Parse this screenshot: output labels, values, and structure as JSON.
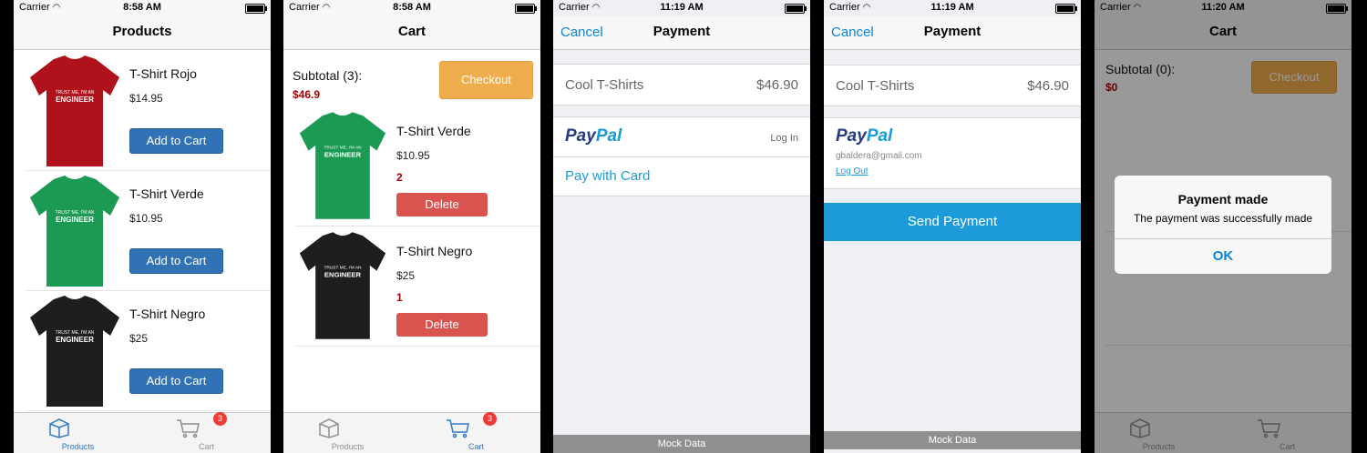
{
  "screens": [
    {
      "status": {
        "carrier": "Carrier",
        "time": "8:58 AM"
      },
      "nav_title": "Products",
      "products": [
        {
          "name": "T-Shirt Rojo",
          "price": "$14.95",
          "button": "Add to Cart",
          "color": "#b0121b"
        },
        {
          "name": "T-Shirt Verde",
          "price": "$10.95",
          "button": "Add to Cart",
          "color": "#1c9a53"
        },
        {
          "name": "T-Shirt Negro",
          "price": "$25",
          "button": "Add to Cart",
          "color": "#1e1e1e"
        }
      ],
      "shirt_text": {
        "line1": "TRUST ME, I'M AN",
        "line2": "ENGINEER"
      },
      "tabs": {
        "products": "Products",
        "cart": "Cart",
        "badge": "3"
      }
    },
    {
      "status": {
        "carrier": "Carrier",
        "time": "8:58 AM"
      },
      "nav_title": "Cart",
      "subtotal_label": "Subtotal (3):",
      "subtotal_amount": "$46.9",
      "checkout": "Checkout",
      "items": [
        {
          "name": "T-Shirt Verde",
          "price": "$10.95",
          "qty": "2",
          "button": "Delete",
          "color": "#1c9a53"
        },
        {
          "name": "T-Shirt Negro",
          "price": "$25",
          "qty": "1",
          "button": "Delete",
          "color": "#1e1e1e"
        }
      ],
      "tabs": {
        "products": "Products",
        "cart": "Cart",
        "badge": "3"
      }
    },
    {
      "status": {
        "carrier": "Carrier",
        "time": "11:19 AM"
      },
      "cancel": "Cancel",
      "nav_title": "Payment",
      "merchant": "Cool T-Shirts",
      "amount": "$46.90",
      "paypal": {
        "part1": "Pay",
        "part2": "Pal"
      },
      "login": "Log In",
      "pay_card": "Pay with Card",
      "mock": "Mock Data"
    },
    {
      "status": {
        "carrier": "Carrier",
        "time": "11:19 AM"
      },
      "cancel": "Cancel",
      "nav_title": "Payment",
      "merchant": "Cool T-Shirts",
      "amount": "$46.90",
      "paypal": {
        "part1": "Pay",
        "part2": "Pal"
      },
      "email": "gbaldera@gmail.com",
      "logout": "Log Out",
      "send": "Send Payment",
      "mock": "Mock Data"
    },
    {
      "status": {
        "carrier": "Carrier",
        "time": "11:20 AM"
      },
      "nav_title": "Cart",
      "subtotal_label": "Subtotal (0):",
      "subtotal_amount": "$0",
      "checkout": "Checkout",
      "alert": {
        "title": "Payment made",
        "message": "The payment was successfully made",
        "ok": "OK"
      },
      "tabs": {
        "products": "Products",
        "cart": "Cart"
      }
    }
  ],
  "colors": {
    "ios_blue": "#0a84d6",
    "primary_btn": "#3072b3",
    "danger_btn": "#d9534f",
    "warning_btn": "#f0ad4e",
    "paypal_blue": "#1c9bd8"
  }
}
